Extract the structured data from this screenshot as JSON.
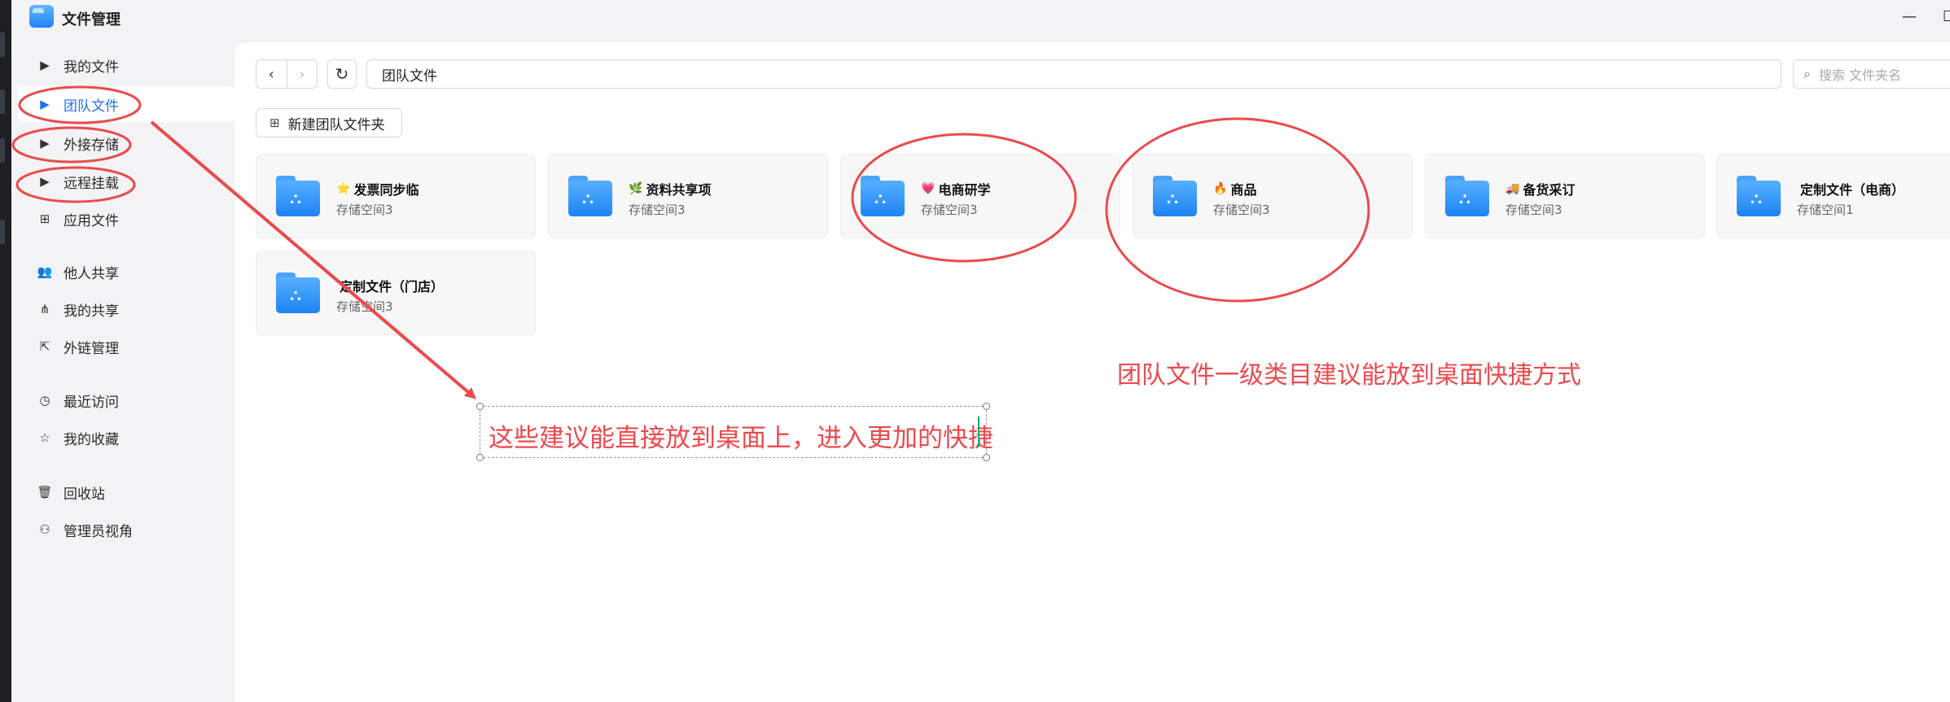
{
  "window": {
    "title": "文件管理",
    "minimize_glyph": "—",
    "maximize_glyph": "☐"
  },
  "sidebar": {
    "items": [
      {
        "label": "我的文件",
        "icon": "caret-right-icon",
        "active": false
      },
      {
        "label": "团队文件",
        "icon": "caret-right-icon",
        "active": true
      },
      {
        "label": "外接存储",
        "icon": "caret-right-icon",
        "active": false
      },
      {
        "label": "远程挂载",
        "icon": "caret-right-icon",
        "active": false
      },
      {
        "label": "应用文件",
        "icon": "apps-grid-icon",
        "active": false
      },
      {
        "label": "他人共享",
        "icon": "users-icon",
        "active": false
      },
      {
        "label": "我的共享",
        "icon": "share-icon",
        "active": false
      },
      {
        "label": "外链管理",
        "icon": "external-link-icon",
        "active": false
      },
      {
        "label": "最近访问",
        "icon": "clock-icon",
        "active": false
      },
      {
        "label": "我的收藏",
        "icon": "star-icon",
        "active": false
      },
      {
        "label": "回收站",
        "icon": "trash-icon",
        "active": false
      },
      {
        "label": "管理员视角",
        "icon": "admin-user-icon",
        "active": false
      }
    ]
  },
  "toolbar": {
    "back_glyph": "‹",
    "forward_glyph": "›",
    "refresh_glyph": "↻",
    "path": "团队文件",
    "search_placeholder": "搜索 文件夹名",
    "new_folder_label": "新建团队文件夹"
  },
  "folders": [
    {
      "emoji": "⭐",
      "name": "发票同步临",
      "space": "存储空间3"
    },
    {
      "emoji": "🌿",
      "name": "资料共享项",
      "space": "存储空间3"
    },
    {
      "emoji": "💗",
      "name": "电商研学",
      "space": "存储空间3"
    },
    {
      "emoji": "🔥",
      "name": "商品",
      "space": "存储空间3"
    },
    {
      "emoji": "🚚",
      "name": "备货采订",
      "space": "存储空间3"
    },
    {
      "emoji": "",
      "name": "定制文件（电商）",
      "space": "存储空间1"
    },
    {
      "emoji": "",
      "name": "定制文件（门店）",
      "space": "存储空间3"
    }
  ],
  "annotations": {
    "note_right": "团队文件一级类目建议能放到桌面快捷方式",
    "note_box": "这些建议能直接放到桌面上，进入更加的快捷",
    "color": "#ea4a4e"
  }
}
